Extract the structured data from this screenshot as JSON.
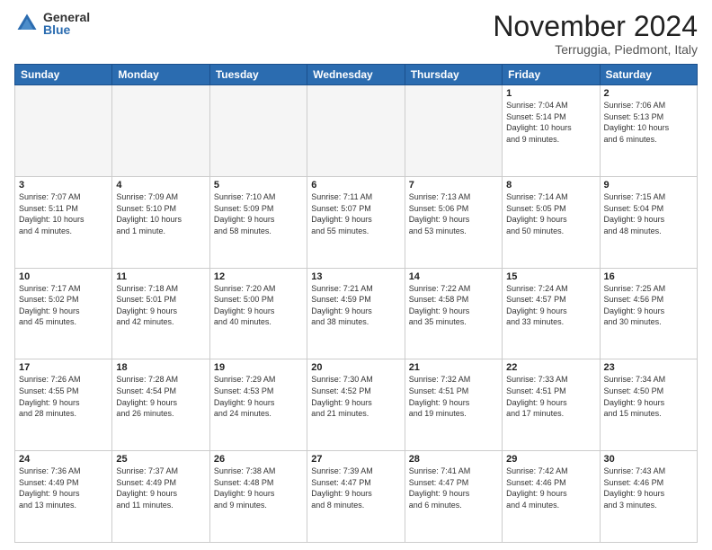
{
  "logo": {
    "general": "General",
    "blue": "Blue"
  },
  "header": {
    "month": "November 2024",
    "location": "Terruggia, Piedmont, Italy"
  },
  "weekdays": [
    "Sunday",
    "Monday",
    "Tuesday",
    "Wednesday",
    "Thursday",
    "Friday",
    "Saturday"
  ],
  "weeks": [
    [
      {
        "day": "",
        "info": "",
        "empty": true
      },
      {
        "day": "",
        "info": "",
        "empty": true
      },
      {
        "day": "",
        "info": "",
        "empty": true
      },
      {
        "day": "",
        "info": "",
        "empty": true
      },
      {
        "day": "",
        "info": "",
        "empty": true
      },
      {
        "day": "1",
        "info": "Sunrise: 7:04 AM\nSunset: 5:14 PM\nDaylight: 10 hours\nand 9 minutes.",
        "empty": false
      },
      {
        "day": "2",
        "info": "Sunrise: 7:06 AM\nSunset: 5:13 PM\nDaylight: 10 hours\nand 6 minutes.",
        "empty": false
      }
    ],
    [
      {
        "day": "3",
        "info": "Sunrise: 7:07 AM\nSunset: 5:11 PM\nDaylight: 10 hours\nand 4 minutes.",
        "empty": false
      },
      {
        "day": "4",
        "info": "Sunrise: 7:09 AM\nSunset: 5:10 PM\nDaylight: 10 hours\nand 1 minute.",
        "empty": false
      },
      {
        "day": "5",
        "info": "Sunrise: 7:10 AM\nSunset: 5:09 PM\nDaylight: 9 hours\nand 58 minutes.",
        "empty": false
      },
      {
        "day": "6",
        "info": "Sunrise: 7:11 AM\nSunset: 5:07 PM\nDaylight: 9 hours\nand 55 minutes.",
        "empty": false
      },
      {
        "day": "7",
        "info": "Sunrise: 7:13 AM\nSunset: 5:06 PM\nDaylight: 9 hours\nand 53 minutes.",
        "empty": false
      },
      {
        "day": "8",
        "info": "Sunrise: 7:14 AM\nSunset: 5:05 PM\nDaylight: 9 hours\nand 50 minutes.",
        "empty": false
      },
      {
        "day": "9",
        "info": "Sunrise: 7:15 AM\nSunset: 5:04 PM\nDaylight: 9 hours\nand 48 minutes.",
        "empty": false
      }
    ],
    [
      {
        "day": "10",
        "info": "Sunrise: 7:17 AM\nSunset: 5:02 PM\nDaylight: 9 hours\nand 45 minutes.",
        "empty": false
      },
      {
        "day": "11",
        "info": "Sunrise: 7:18 AM\nSunset: 5:01 PM\nDaylight: 9 hours\nand 42 minutes.",
        "empty": false
      },
      {
        "day": "12",
        "info": "Sunrise: 7:20 AM\nSunset: 5:00 PM\nDaylight: 9 hours\nand 40 minutes.",
        "empty": false
      },
      {
        "day": "13",
        "info": "Sunrise: 7:21 AM\nSunset: 4:59 PM\nDaylight: 9 hours\nand 38 minutes.",
        "empty": false
      },
      {
        "day": "14",
        "info": "Sunrise: 7:22 AM\nSunset: 4:58 PM\nDaylight: 9 hours\nand 35 minutes.",
        "empty": false
      },
      {
        "day": "15",
        "info": "Sunrise: 7:24 AM\nSunset: 4:57 PM\nDaylight: 9 hours\nand 33 minutes.",
        "empty": false
      },
      {
        "day": "16",
        "info": "Sunrise: 7:25 AM\nSunset: 4:56 PM\nDaylight: 9 hours\nand 30 minutes.",
        "empty": false
      }
    ],
    [
      {
        "day": "17",
        "info": "Sunrise: 7:26 AM\nSunset: 4:55 PM\nDaylight: 9 hours\nand 28 minutes.",
        "empty": false
      },
      {
        "day": "18",
        "info": "Sunrise: 7:28 AM\nSunset: 4:54 PM\nDaylight: 9 hours\nand 26 minutes.",
        "empty": false
      },
      {
        "day": "19",
        "info": "Sunrise: 7:29 AM\nSunset: 4:53 PM\nDaylight: 9 hours\nand 24 minutes.",
        "empty": false
      },
      {
        "day": "20",
        "info": "Sunrise: 7:30 AM\nSunset: 4:52 PM\nDaylight: 9 hours\nand 21 minutes.",
        "empty": false
      },
      {
        "day": "21",
        "info": "Sunrise: 7:32 AM\nSunset: 4:51 PM\nDaylight: 9 hours\nand 19 minutes.",
        "empty": false
      },
      {
        "day": "22",
        "info": "Sunrise: 7:33 AM\nSunset: 4:51 PM\nDaylight: 9 hours\nand 17 minutes.",
        "empty": false
      },
      {
        "day": "23",
        "info": "Sunrise: 7:34 AM\nSunset: 4:50 PM\nDaylight: 9 hours\nand 15 minutes.",
        "empty": false
      }
    ],
    [
      {
        "day": "24",
        "info": "Sunrise: 7:36 AM\nSunset: 4:49 PM\nDaylight: 9 hours\nand 13 minutes.",
        "empty": false
      },
      {
        "day": "25",
        "info": "Sunrise: 7:37 AM\nSunset: 4:49 PM\nDaylight: 9 hours\nand 11 minutes.",
        "empty": false
      },
      {
        "day": "26",
        "info": "Sunrise: 7:38 AM\nSunset: 4:48 PM\nDaylight: 9 hours\nand 9 minutes.",
        "empty": false
      },
      {
        "day": "27",
        "info": "Sunrise: 7:39 AM\nSunset: 4:47 PM\nDaylight: 9 hours\nand 8 minutes.",
        "empty": false
      },
      {
        "day": "28",
        "info": "Sunrise: 7:41 AM\nSunset: 4:47 PM\nDaylight: 9 hours\nand 6 minutes.",
        "empty": false
      },
      {
        "day": "29",
        "info": "Sunrise: 7:42 AM\nSunset: 4:46 PM\nDaylight: 9 hours\nand 4 minutes.",
        "empty": false
      },
      {
        "day": "30",
        "info": "Sunrise: 7:43 AM\nSunset: 4:46 PM\nDaylight: 9 hours\nand 3 minutes.",
        "empty": false
      }
    ]
  ]
}
